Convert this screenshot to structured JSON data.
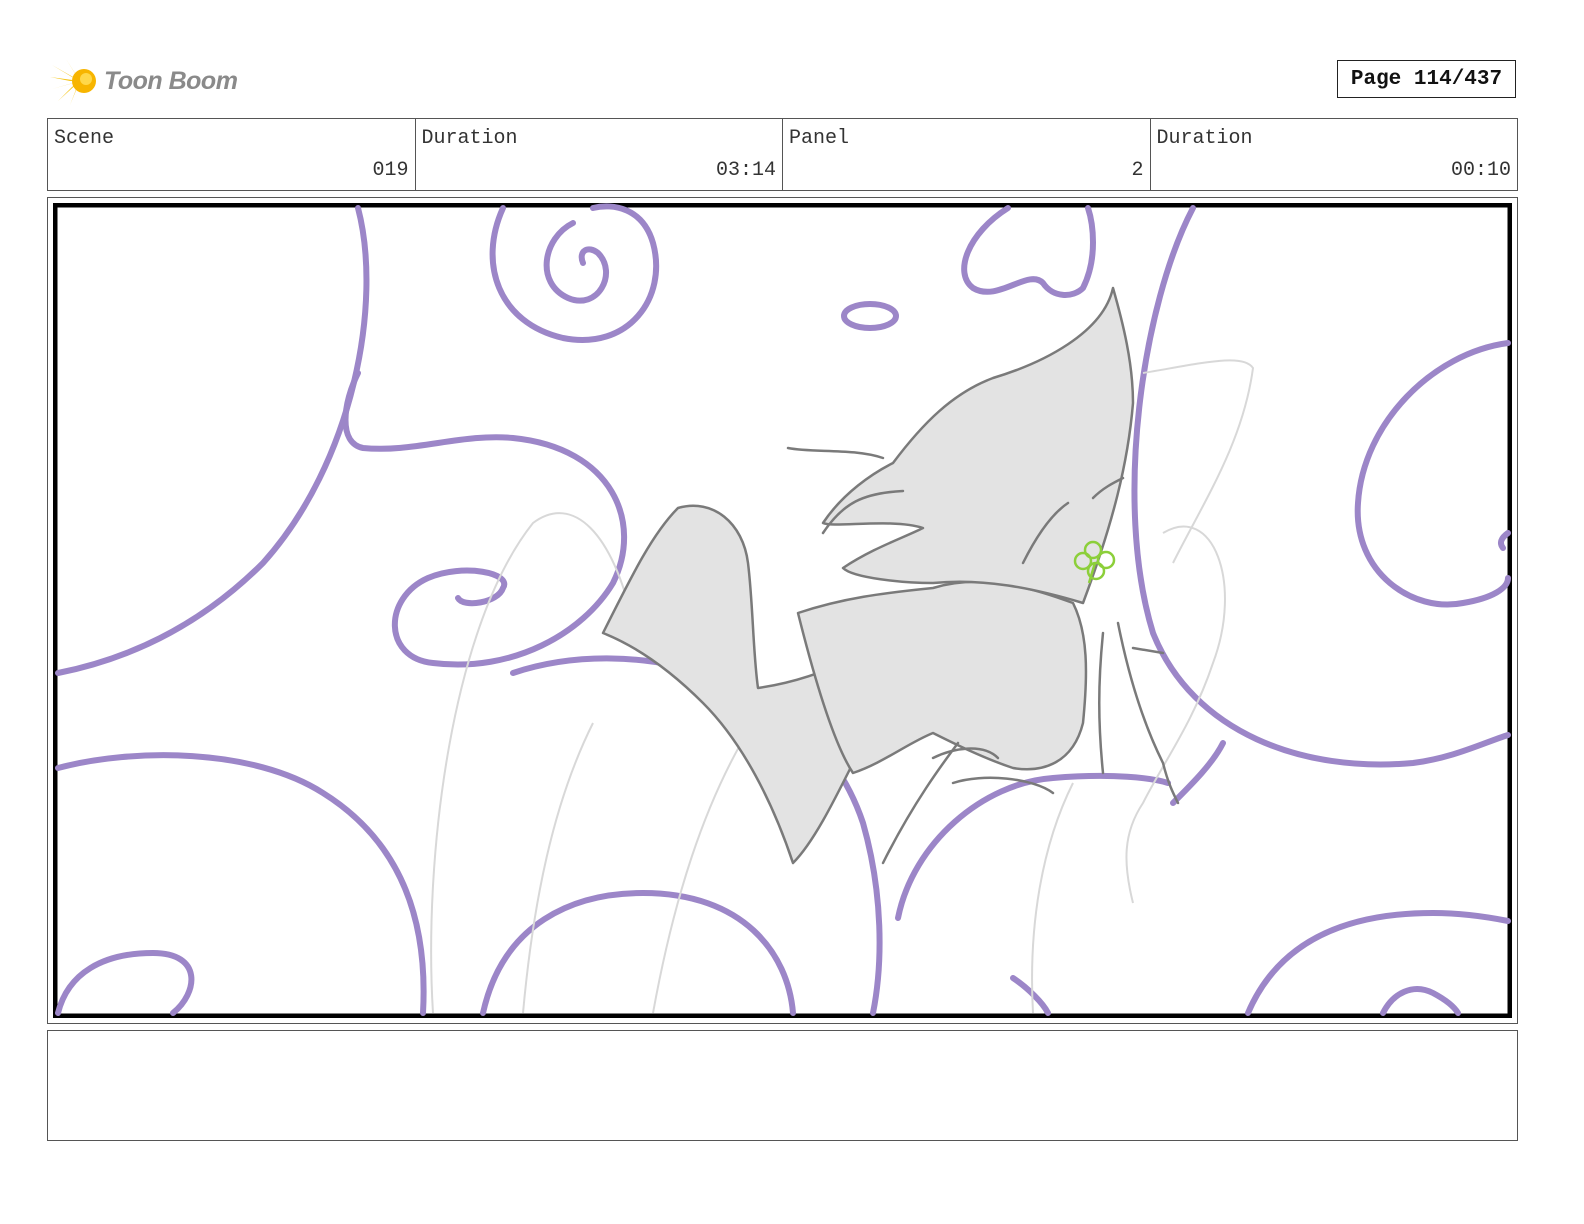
{
  "header": {
    "logo_text": "Toon Boom",
    "page_label": "Page 114/437"
  },
  "info": {
    "scene_label": "Scene",
    "scene_value": "019",
    "scene_duration_label": "Duration",
    "scene_duration_value": "03:14",
    "panel_label": "Panel",
    "panel_value": "2",
    "panel_duration_label": "Duration",
    "panel_duration_value": "00:10"
  },
  "notes": {
    "text": ""
  },
  "colors": {
    "swirl": "#9c86c8",
    "sketch": "#7a7a7a",
    "fill": "#e3e3e3",
    "clover": "#8ccf3a",
    "logo_star": "#f5c518"
  }
}
